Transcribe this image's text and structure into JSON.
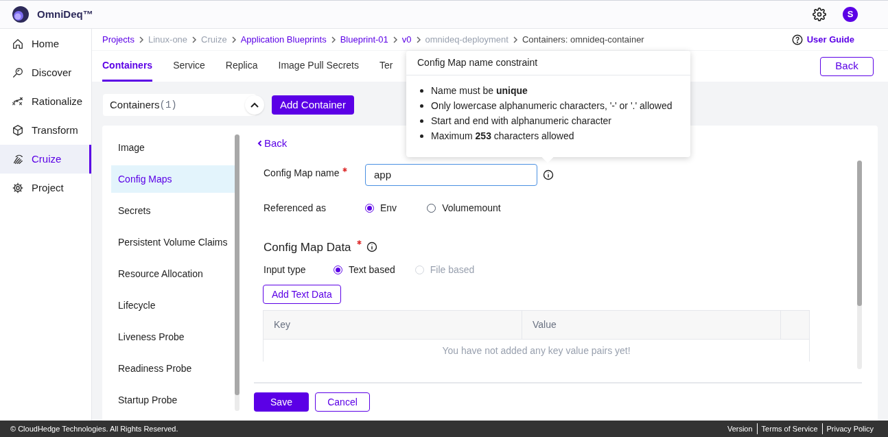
{
  "app": {
    "name": "OmniDeq™",
    "avatar": "S"
  },
  "nav": [
    {
      "label": "Home",
      "selected": false
    },
    {
      "label": "Discover",
      "selected": false
    },
    {
      "label": "Rationalize",
      "selected": false
    },
    {
      "label": "Transform",
      "selected": false
    },
    {
      "label": "Cruize",
      "selected": true
    },
    {
      "label": "Project",
      "selected": false
    }
  ],
  "breadcrumb": [
    {
      "label": "Projects",
      "kind": "link"
    },
    {
      "label": "Linux-one",
      "kind": "plain"
    },
    {
      "label": "Cruize",
      "kind": "plain"
    },
    {
      "label": "Application Blueprints",
      "kind": "link"
    },
    {
      "label": "Blueprint-01",
      "kind": "link"
    },
    {
      "label": "v0",
      "kind": "link"
    },
    {
      "label": "omnideq-deployment",
      "kind": "plain"
    },
    {
      "label": "Containers: omnideq-container",
      "kind": "current"
    }
  ],
  "user_guide": "User Guide",
  "tabs": [
    {
      "label": "Containers",
      "selected": true
    },
    {
      "label": "Service",
      "selected": false
    },
    {
      "label": "Replica",
      "selected": false
    },
    {
      "label": "Image Pull Secrets",
      "selected": false
    },
    {
      "label": "Ter",
      "selected": false
    }
  ],
  "back_button": "Back",
  "containers": {
    "label": "Containers",
    "count": "(1)",
    "expanded": true
  },
  "add_container": "Add Container",
  "side_menu": [
    {
      "label": "Image",
      "selected": false
    },
    {
      "label": "Config Maps",
      "selected": true
    },
    {
      "label": "Secrets",
      "selected": false
    },
    {
      "label": "Persistent Volume Claims",
      "selected": false
    },
    {
      "label": "Resource Allocation",
      "selected": false
    },
    {
      "label": "Lifecycle",
      "selected": false
    },
    {
      "label": "Liveness Probe",
      "selected": false
    },
    {
      "label": "Readiness Probe",
      "selected": false
    },
    {
      "label": "Startup Probe",
      "selected": false
    }
  ],
  "form": {
    "back_link": "Back",
    "name_field": {
      "label": "Config Map name",
      "required": true,
      "value": "app"
    },
    "referenced_as": {
      "label": "Referenced as",
      "options": [
        {
          "label": "Env",
          "selected": true,
          "disabled": false
        },
        {
          "label": "Volumemount",
          "selected": false,
          "disabled": false
        }
      ]
    },
    "data_section": {
      "title": "Config Map Data",
      "required": true
    },
    "input_type": {
      "label": "Input type",
      "options": [
        {
          "label": "Text based",
          "selected": true,
          "disabled": false
        },
        {
          "label": "File based",
          "selected": false,
          "disabled": true
        }
      ]
    },
    "add_text_data": "Add Text Data",
    "table": {
      "columns": [
        "Key",
        "Value"
      ],
      "empty_message": "You have not added any key value pairs yet!"
    },
    "save": "Save",
    "cancel": "Cancel"
  },
  "tooltip": {
    "title": "Config Map name constraint",
    "items": [
      "Name must be **unique**",
      "Only lowercase alphanumeric characters, '-' or '.' allowed",
      "Start and end with alphanumeric character",
      "Maximum **253** characters allowed"
    ]
  },
  "footer": {
    "copyright": "© CloudHedge Technologies. All Rights Reserved.",
    "links": [
      "Version",
      "Terms of Service",
      "Privacy Policy"
    ]
  }
}
